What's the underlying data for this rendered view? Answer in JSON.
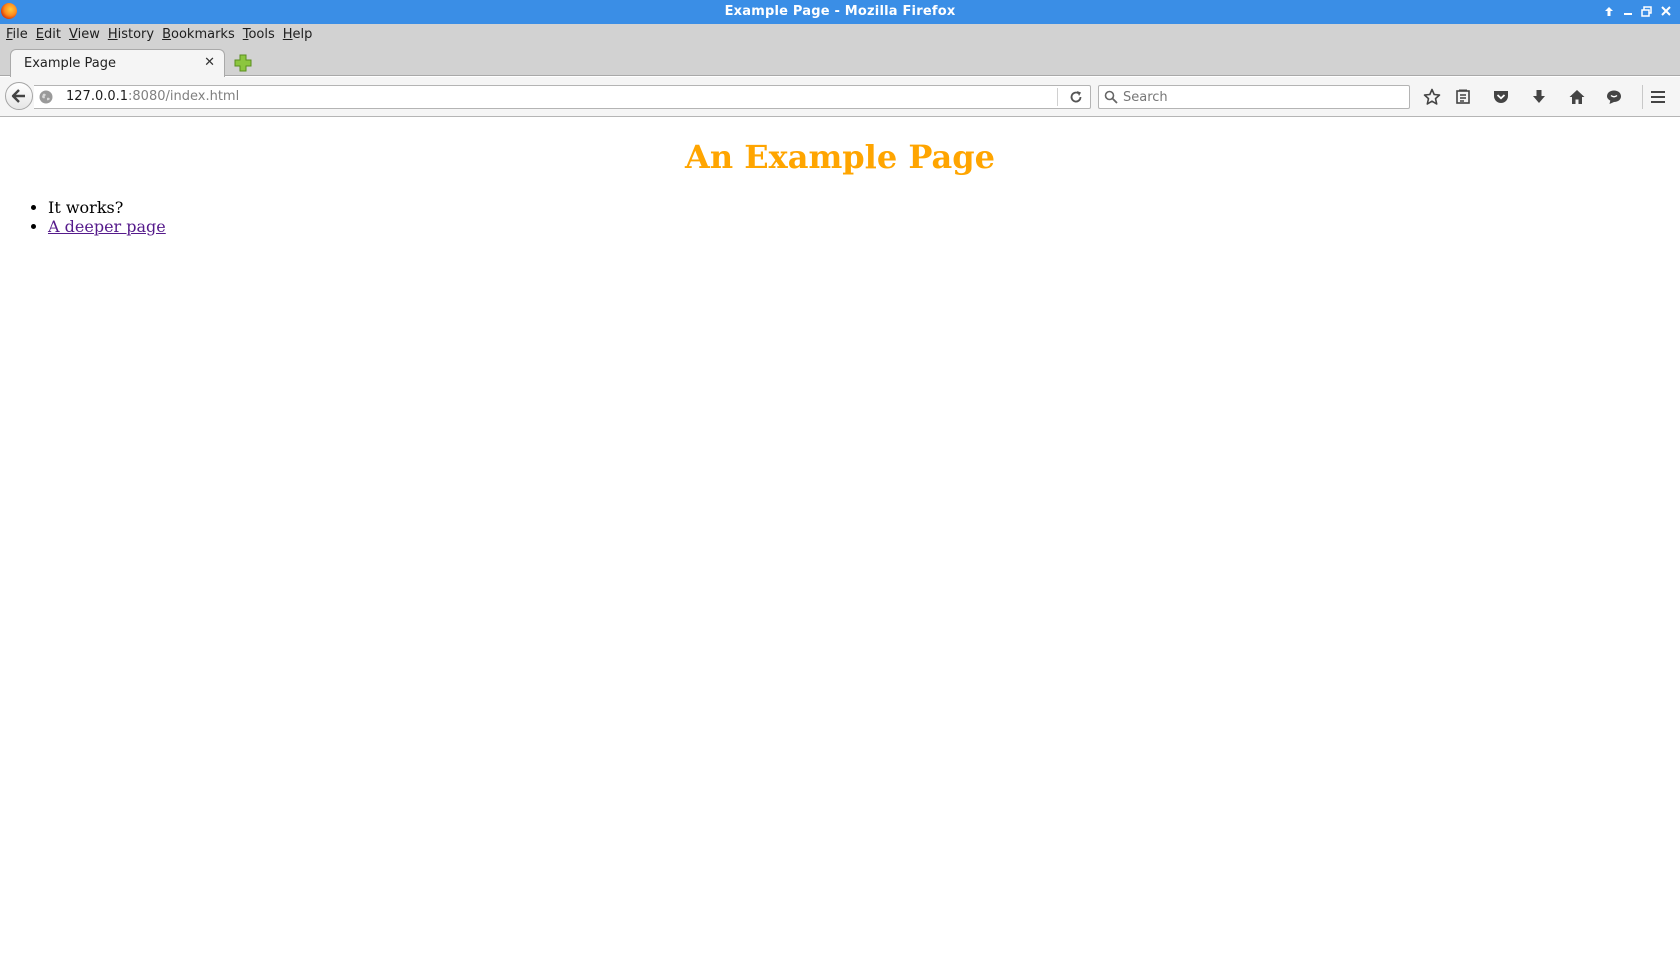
{
  "window": {
    "title": "Example Page - Mozilla Firefox",
    "controls": [
      "up-arrow-icon",
      "minimize-icon",
      "maximize-icon",
      "close-icon"
    ]
  },
  "menubar": {
    "items": [
      {
        "label": "File"
      },
      {
        "label": "Edit"
      },
      {
        "label": "View"
      },
      {
        "label": "History"
      },
      {
        "label": "Bookmarks"
      },
      {
        "label": "Tools"
      },
      {
        "label": "Help"
      }
    ]
  },
  "tabs": [
    {
      "label": "Example Page",
      "active": true
    }
  ],
  "navbar": {
    "url_host": "127.0.0.1",
    "url_rest": ":8080/index.html",
    "search_placeholder": "Search",
    "toolbar_icons": [
      "bookmark-star-icon",
      "reading-list-icon",
      "pocket-icon",
      "download-icon",
      "home-icon",
      "chat-icon",
      "hamburger-menu-icon"
    ]
  },
  "page": {
    "heading": "An Example Page",
    "heading_color": "#ffa500",
    "list": [
      {
        "text": "It works?"
      },
      {
        "text": "A deeper page",
        "link": true
      }
    ],
    "link_color": "#551a8b"
  }
}
